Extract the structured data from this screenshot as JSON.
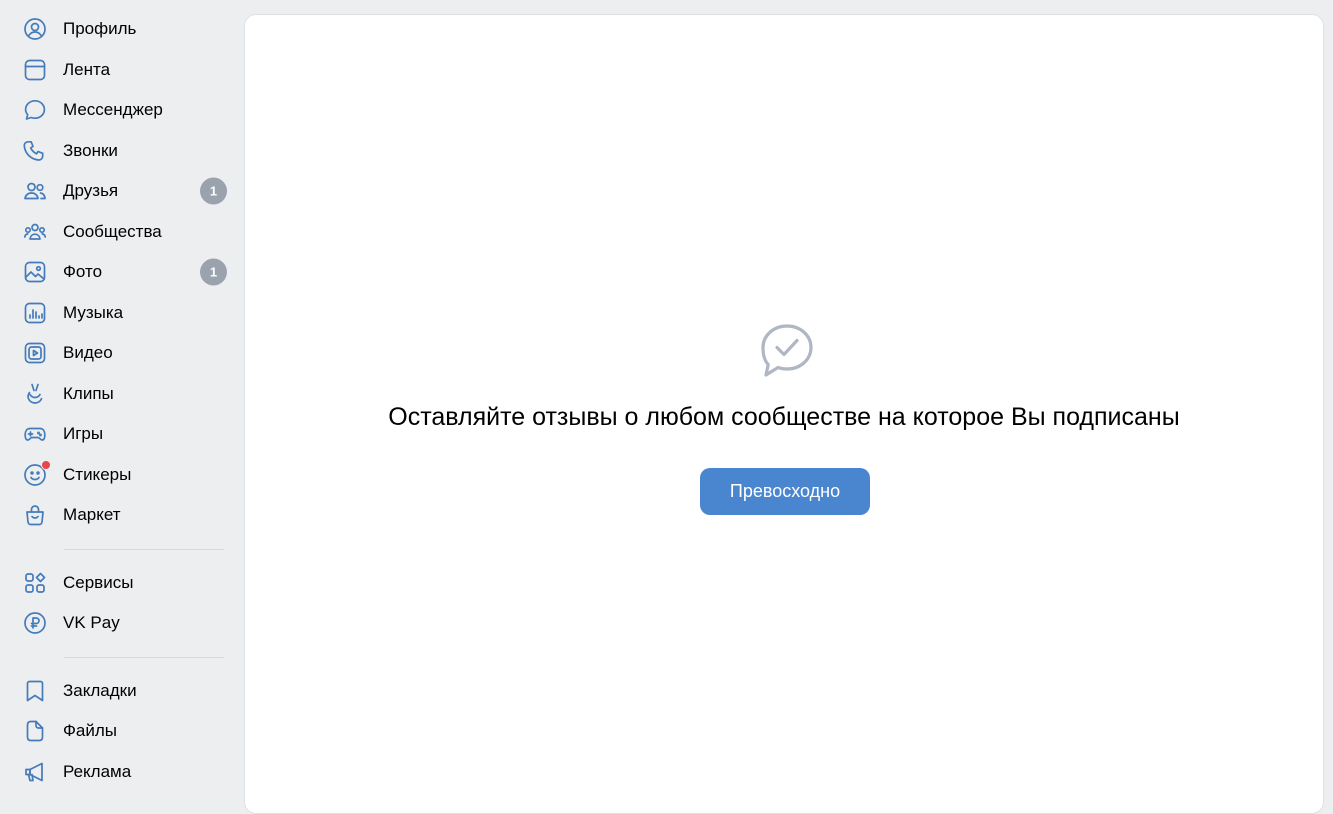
{
  "sidebar": {
    "main": [
      {
        "label": "Профиль",
        "icon": "profile-icon"
      },
      {
        "label": "Лента",
        "icon": "feed-icon"
      },
      {
        "label": "Мессенджер",
        "icon": "messenger-icon"
      },
      {
        "label": "Звонки",
        "icon": "phone-icon"
      },
      {
        "label": "Друзья",
        "icon": "friends-icon",
        "badge": "1"
      },
      {
        "label": "Сообщества",
        "icon": "communities-icon"
      },
      {
        "label": "Фото",
        "icon": "photo-icon",
        "badge": "1"
      },
      {
        "label": "Музыка",
        "icon": "music-icon"
      },
      {
        "label": "Видео",
        "icon": "video-icon"
      },
      {
        "label": "Клипы",
        "icon": "clips-icon"
      },
      {
        "label": "Игры",
        "icon": "gamepad-icon"
      },
      {
        "label": "Стикеры",
        "icon": "smile-icon",
        "dot": true
      },
      {
        "label": "Маркет",
        "icon": "shopping-bag-icon"
      }
    ],
    "services": [
      {
        "label": "Сервисы",
        "icon": "services-grid-icon"
      },
      {
        "label": "VK Pay",
        "icon": "ruble-icon"
      }
    ],
    "extra": [
      {
        "label": "Закладки",
        "icon": "bookmark-icon"
      },
      {
        "label": "Файлы",
        "icon": "file-icon"
      },
      {
        "label": "Реклама",
        "icon": "megaphone-icon"
      }
    ]
  },
  "main": {
    "empty_icon": "chat-check-icon",
    "message": "Оставляйте отзывы о любом сообществе на которое Вы подписаны",
    "button_label": "Превосходно"
  },
  "colors": {
    "accent": "#447bba",
    "button": "#4a86cf",
    "badge": "#99a2ad",
    "notification_dot": "#e64646",
    "background": "#edeef0"
  }
}
